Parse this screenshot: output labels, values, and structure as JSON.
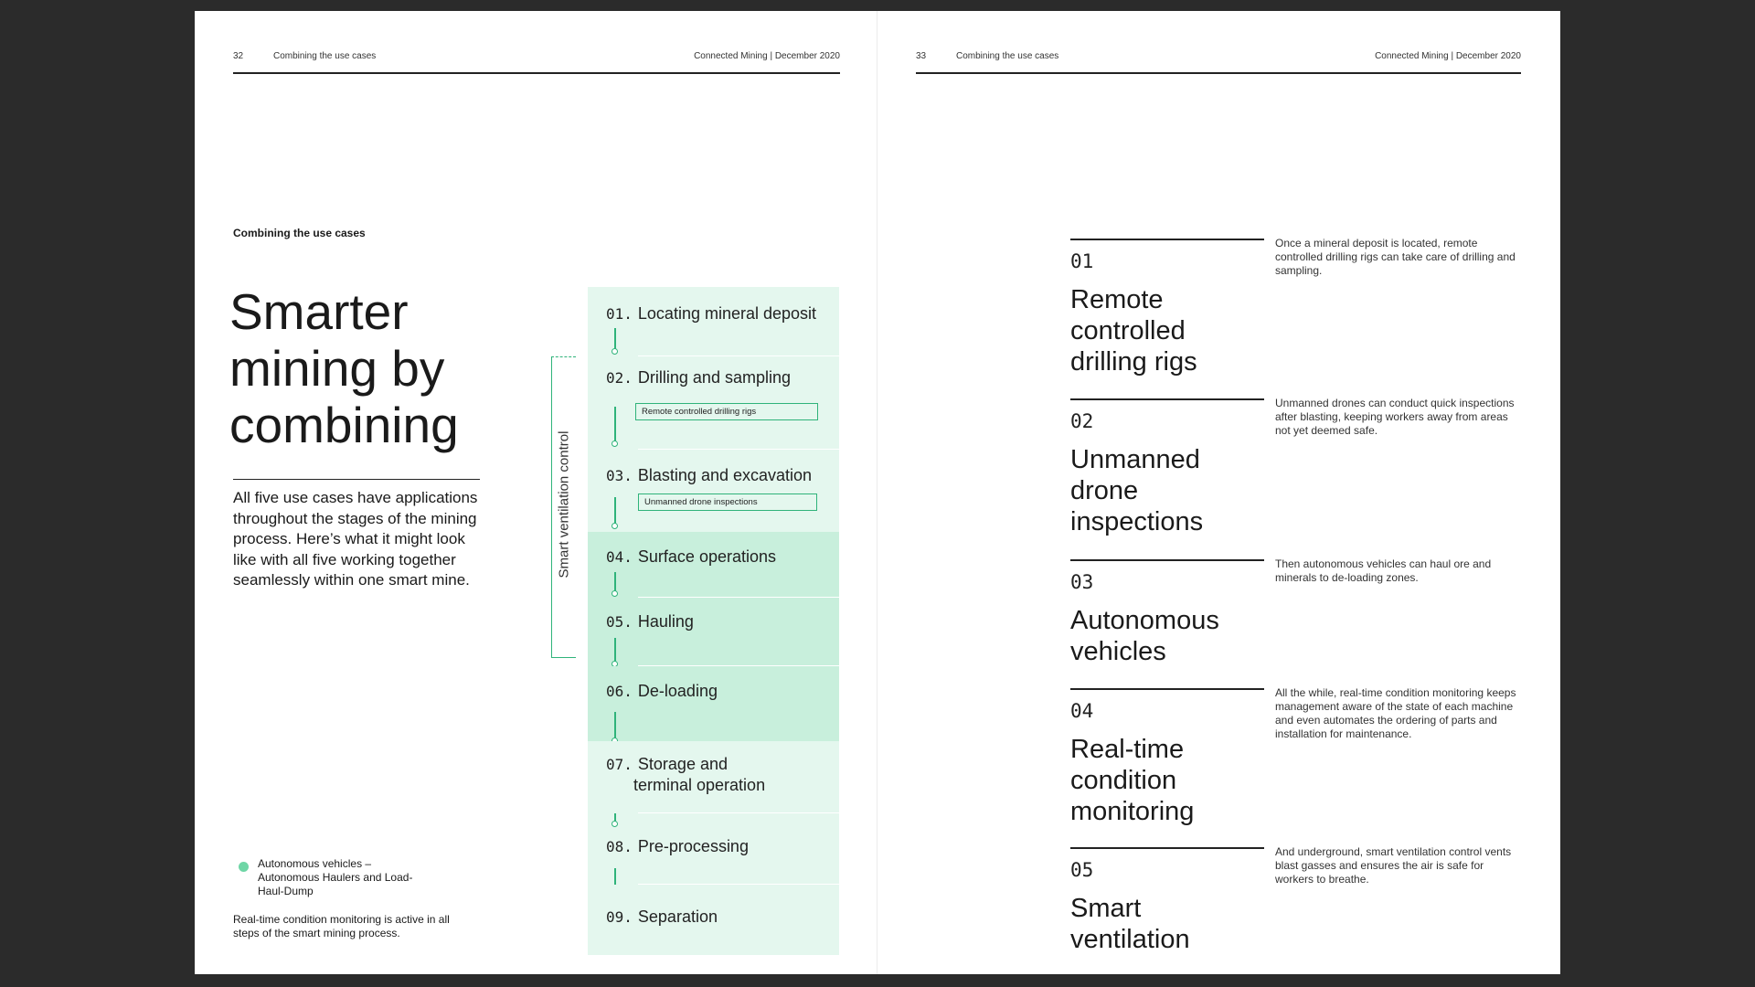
{
  "left_page": {
    "header": {
      "page_number": "32",
      "section": "Combining the use cases",
      "publication": "Connected Mining | December 2020"
    },
    "section_label": "Combining the use cases",
    "title": "Smarter mining by combining",
    "intro": "All five use cases have applications throughout the stages of the mining process. Here’s what it might look like with all five working together seamlessly within one smart mine.",
    "legend": "Autonomous vehicles – Autonomous Haulers and Load-Haul-Dump",
    "footnote": "Real-time condition monitoring is active in all steps of the smart mining process.",
    "ventilation_label": "Smart ventilation control",
    "stages": [
      {
        "num": "01.",
        "label": "Locating mineral deposit"
      },
      {
        "num": "02.",
        "label": "Drilling and sampling",
        "sub": "Remote controlled drilling rigs"
      },
      {
        "num": "03.",
        "label": "Blasting and excavation",
        "sub": "Unmanned drone inspections"
      },
      {
        "num": "04.",
        "label": "Surface operations"
      },
      {
        "num": "05.",
        "label": "Hauling"
      },
      {
        "num": "06.",
        "label": "De-loading"
      },
      {
        "num": "07.",
        "label": "Storage and",
        "label2": "terminal operation"
      },
      {
        "num": "08.",
        "label": "Pre-processing"
      },
      {
        "num": "09.",
        "label": "Separation"
      }
    ],
    "colors": {
      "light": "#e4f7ee",
      "mid": "#c8efdc",
      "accent": "#2fb37a",
      "dot": "#6fd6a6"
    }
  },
  "right_page": {
    "header": {
      "page_number": "33",
      "section": "Combining the use cases",
      "publication": "Connected Mining | December 2020"
    },
    "use_cases": [
      {
        "num": "01",
        "title": "Remote controlled drilling rigs",
        "desc": "Once a mineral deposit is located, remote controlled drilling rigs can take care of drilling and sampling."
      },
      {
        "num": "02",
        "title": "Unmanned drone inspections",
        "desc": "Unmanned drones can conduct quick inspections after blasting, keeping workers away from areas not yet deemed safe."
      },
      {
        "num": "03",
        "title": "Autonomous vehicles",
        "desc": "Then autonomous vehicles can haul ore and minerals to de-loading zones."
      },
      {
        "num": "04",
        "title": "Real-time condition monitoring",
        "desc": "All the while, real-time condition monitoring keeps management aware of the state of each machine and even automates the ordering of parts and installation for maintenance."
      },
      {
        "num": "05",
        "title": "Smart ventilation",
        "desc": "And underground, smart ventilation control vents blast gasses and ensures the air is safe for workers to breathe."
      }
    ]
  }
}
